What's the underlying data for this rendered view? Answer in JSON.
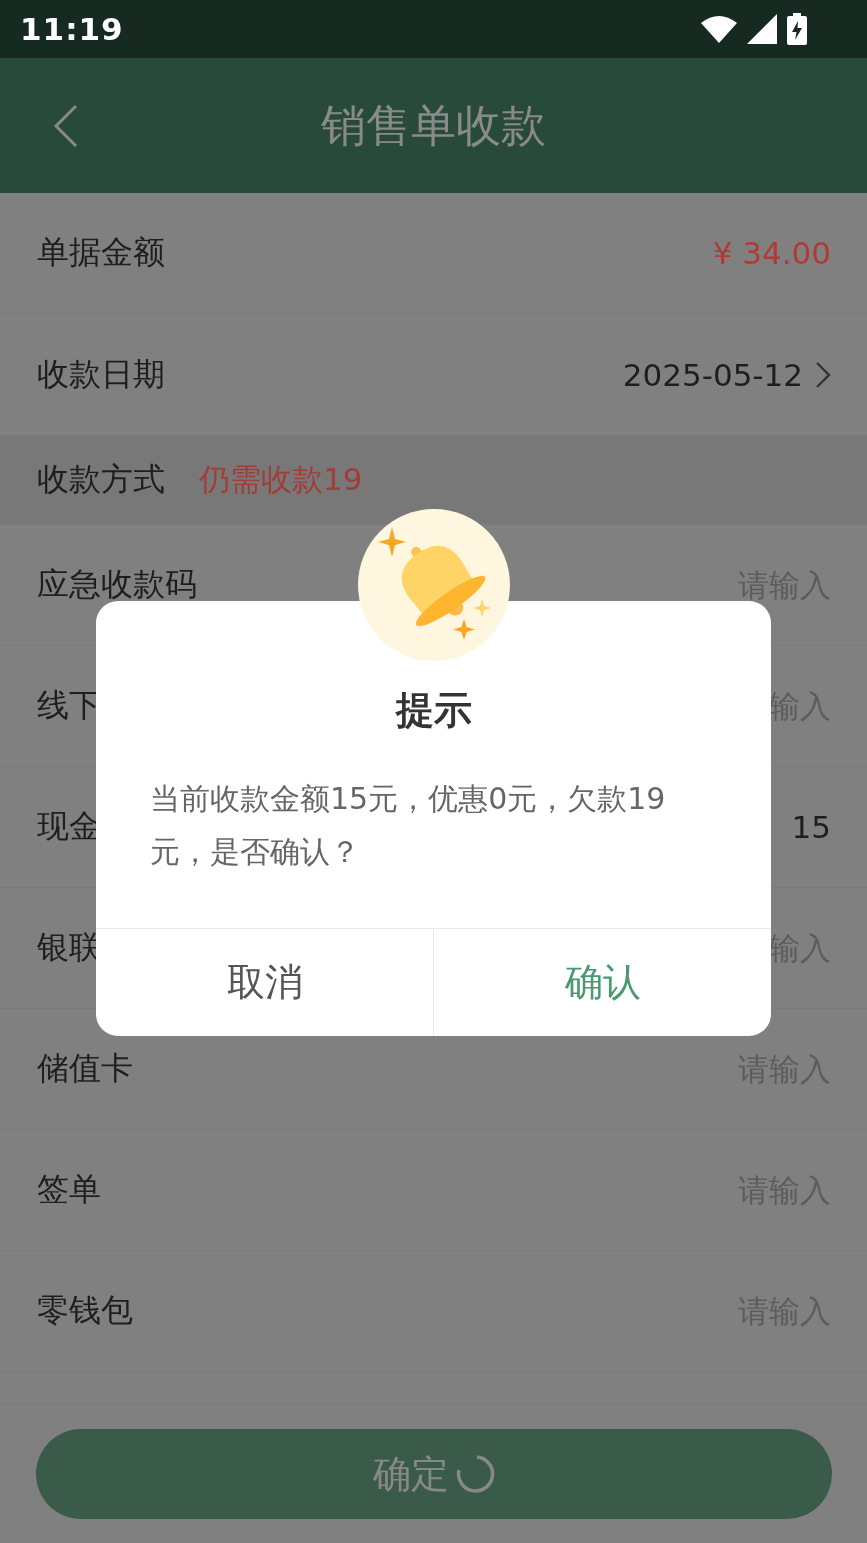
{
  "status_bar": {
    "time": "11:19"
  },
  "header": {
    "title": "销售单收款"
  },
  "summary_rows": [
    {
      "label": "单据金额",
      "value": "¥ 34.00",
      "kind": "amount"
    },
    {
      "label": "收款日期",
      "value": "2025-05-12",
      "kind": "date"
    }
  ],
  "payment_section": {
    "label": "收款方式",
    "note": "仍需收款19"
  },
  "payment_methods": [
    {
      "label": "应急收款码",
      "placeholder": "请输入"
    },
    {
      "label": "线下",
      "placeholder": "输入"
    },
    {
      "label": "现金",
      "value": "15"
    },
    {
      "label": "银联",
      "placeholder": "输入"
    },
    {
      "label": "储值卡",
      "placeholder": "请输入"
    },
    {
      "label": "签单",
      "placeholder": "请输入"
    },
    {
      "label": "零钱包",
      "placeholder": "请输入"
    }
  ],
  "submit_button": {
    "label": "确定",
    "loading": true
  },
  "dialog": {
    "title": "提示",
    "message": "当前收款金额15元，优惠0元，欠款19元，是否确认？",
    "buttons": [
      {
        "label": "取消",
        "kind": "cancel"
      },
      {
        "label": "确认",
        "kind": "confirm"
      }
    ]
  }
}
